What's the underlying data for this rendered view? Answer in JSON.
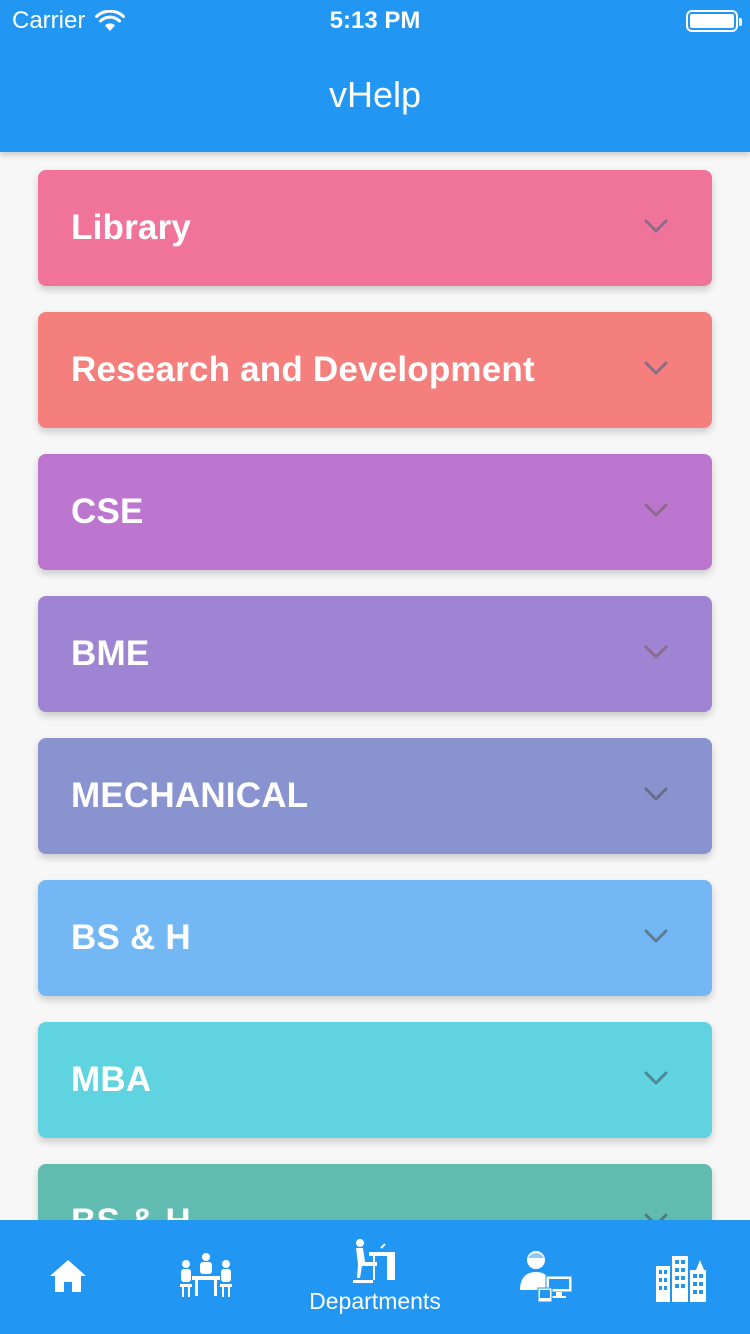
{
  "status_bar": {
    "carrier": "Carrier",
    "time": "5:13 PM"
  },
  "header": {
    "title": "vHelp"
  },
  "departments": [
    {
      "label": "Library",
      "color": "#f0739a"
    },
    {
      "label": "Research and Development",
      "color": "#f47f7c"
    },
    {
      "label": "CSE",
      "color": "#bd76cf"
    },
    {
      "label": "BME",
      "color": "#9e84d3"
    },
    {
      "label": "MECHANICAL",
      "color": "#8893cf"
    },
    {
      "label": "BS & H",
      "color": "#73b8f5"
    },
    {
      "label": "MBA",
      "color": "#5fd3e0"
    },
    {
      "label": "BS & H",
      "color": "#60bbb0"
    }
  ],
  "tabbar": {
    "active_label": "Departments",
    "icons": [
      "home-icon",
      "meeting-icon",
      "departments-icon",
      "staff-computer-icon",
      "buildings-icon"
    ]
  },
  "colors": {
    "primary": "#2196f3",
    "chevron": "#8a6b8c"
  }
}
